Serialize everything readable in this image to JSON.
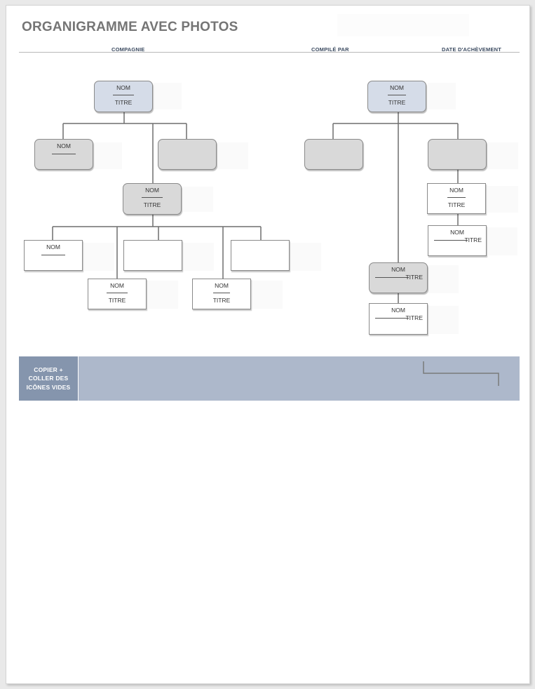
{
  "document": {
    "title": "ORGANIGRAMME AVEC PHOTOS",
    "header_fields": [
      "COMPAGNIE",
      "COMPILÉ PAR",
      "DATE D'ACHÈVEMENT"
    ]
  },
  "chart_labels": {
    "name": "NOM",
    "title": "TITRE"
  },
  "left_tree": {
    "root": {
      "name": "NOM",
      "title": "TITRE",
      "style": "rounded-blue"
    },
    "level1": [
      {
        "name": "NOM",
        "title": "",
        "style": "rounded-grey"
      },
      {
        "name": "",
        "title": "",
        "style": "rounded-grey"
      }
    ],
    "middle": {
      "name": "NOM",
      "title": "TITRE",
      "style": "rounded-grey"
    },
    "level3_top": [
      {
        "name": "NOM",
        "title": "",
        "style": "square"
      },
      {
        "name": "",
        "title": "",
        "style": "square"
      },
      {
        "name": "",
        "title": "",
        "style": "square"
      }
    ],
    "level3_bottom": [
      {
        "name": "NOM",
        "title": "TITRE",
        "style": "square"
      },
      {
        "name": "NOM",
        "title": "TITRE",
        "style": "square"
      }
    ]
  },
  "right_tree": {
    "root": {
      "name": "NOM",
      "title": "TITRE",
      "style": "rounded-blue"
    },
    "level1": [
      {
        "name": "",
        "title": "",
        "style": "rounded-grey"
      },
      {
        "name": "",
        "title": "",
        "style": "rounded-grey"
      }
    ],
    "right_chain": [
      {
        "name": "NOM",
        "title": "TITRE",
        "style": "square"
      },
      {
        "name": "NOM",
        "title": "TITRE",
        "style": "square-inline"
      }
    ],
    "center_chain": [
      {
        "name": "NOM",
        "title": "TITRE",
        "style": "rounded-grey-inline"
      },
      {
        "name": "NOM",
        "title": "TITRE",
        "style": "square-inline"
      }
    ]
  },
  "copy_panel": {
    "label": "COPIER + COLLER DES ICÔNES VIDES"
  },
  "colors": {
    "root_fill": "#d5dce8",
    "node_fill": "#d9d9d9",
    "panel_dark": "#8595ad",
    "panel_light": "#adb8cb",
    "header_text": "#3b4a60",
    "title_text": "#757575"
  }
}
